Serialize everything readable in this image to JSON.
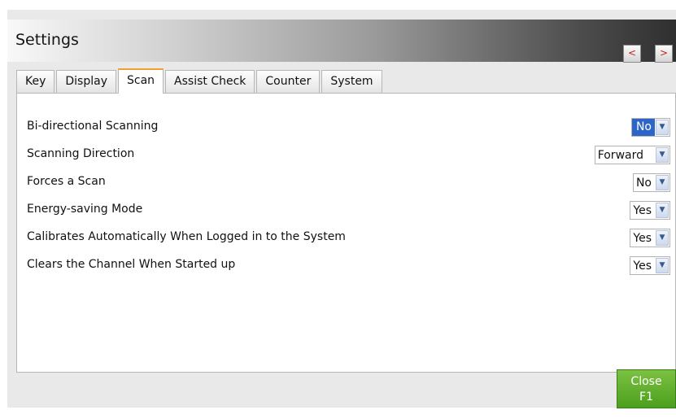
{
  "window": {
    "title": "Settings",
    "nav_prev": "<",
    "nav_next": ">"
  },
  "tabs": [
    {
      "label": "Key",
      "active": false
    },
    {
      "label": "Display",
      "active": false
    },
    {
      "label": "Scan",
      "active": true
    },
    {
      "label": "Assist Check",
      "active": false
    },
    {
      "label": "Counter",
      "active": false
    },
    {
      "label": "System",
      "active": false
    }
  ],
  "settings": [
    {
      "label": "Bi-directional Scanning",
      "value": "No",
      "focused": true
    },
    {
      "label": "Scanning Direction",
      "value": "Forward",
      "focused": false
    },
    {
      "label": "Forces a Scan",
      "value": "No",
      "focused": false
    },
    {
      "label": "Energy-saving Mode",
      "value": "Yes",
      "focused": false
    },
    {
      "label": "Calibrates Automatically When Logged in to the System",
      "value": "Yes",
      "focused": false
    },
    {
      "label": "Clears the Channel When Started up",
      "value": "Yes",
      "focused": false
    }
  ],
  "footer": {
    "close_label": "Close",
    "close_key": "F1"
  },
  "icons": {
    "dropdown_arrow": "chevron-down-icon"
  },
  "colors": {
    "active_tab_accent": "#f0a030",
    "selected_value_bg": "#2d64c8",
    "close_button": "#5aaa28",
    "nav_arrow": "#c02020"
  }
}
